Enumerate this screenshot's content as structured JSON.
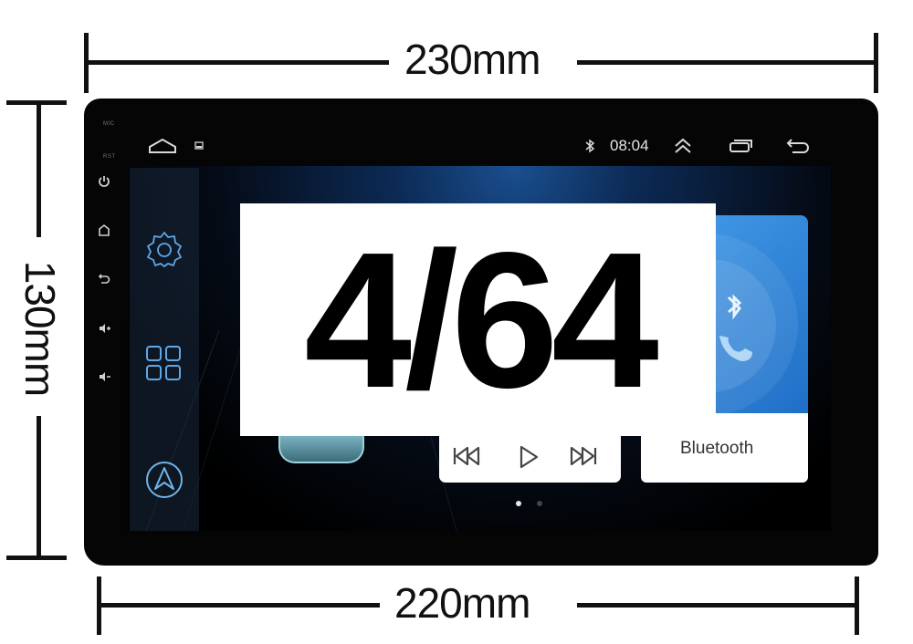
{
  "dimensions": {
    "top_width": "230mm",
    "bottom_width": "220mm",
    "height": "130mm"
  },
  "overlay": {
    "spec_text": "4/64"
  },
  "hardware_buttons": {
    "mic_label": "MIC",
    "rst_label": "RST",
    "buttons": [
      "power-icon",
      "home-icon",
      "back-icon",
      "volume-up-icon",
      "volume-down-icon"
    ]
  },
  "status_bar": {
    "time": "08:04",
    "left_icons": [
      "home-icon",
      "screenshot-icon"
    ],
    "right_icons": [
      "bluetooth-icon",
      "double-chevron-up-icon",
      "recent-apps-icon",
      "back-icon"
    ]
  },
  "dock": {
    "items": [
      "settings-icon",
      "apps-grid-icon",
      "navigation-icon"
    ]
  },
  "cards": {
    "bluetooth_label": "Bluetooth",
    "media_controls": [
      "previous-icon",
      "play-icon",
      "next-icon"
    ]
  },
  "pager": {
    "pages": 2,
    "active_page": 1
  },
  "colors": {
    "accent": "#3f95e3",
    "dock_icon": "#5ea8e8",
    "bezel": "#050505"
  }
}
